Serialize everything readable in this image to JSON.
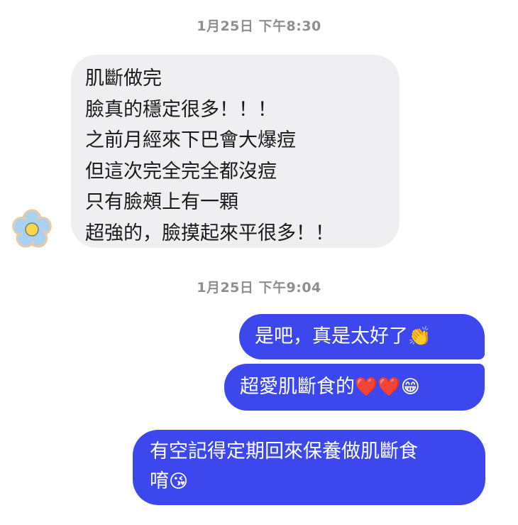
{
  "thread": {
    "timestamp_1": "1月25日 下午8:30",
    "timestamp_2": "1月25日 下午9:04"
  },
  "incoming_message": {
    "lines": [
      "肌斷做完",
      "臉真的穩定很多！！！",
      "之前月經來下巴會大爆痘",
      "但這次完全完全都沒痘",
      "只有臉頰上有一顆",
      "超強的，臉摸起來平很多！！"
    ]
  },
  "outgoing_messages": [
    {
      "text": "是吧，真是太好了",
      "emoji": "👏"
    },
    {
      "text": "超愛肌斷食的",
      "emoji": "❤️❤️😁"
    },
    {
      "lines": [
        "有空記得定期回來保養做肌斷食",
        "唷"
      ],
      "emoji": "😘"
    }
  ],
  "avatar": {
    "icon": "flower-icon",
    "petal_color": "#a9d2f2",
    "center_color": "#f7d84a",
    "outline_color": "#e8c9a8"
  },
  "colors": {
    "outgoing_bubble": "#3c48ee",
    "incoming_bubble": "#efeff1",
    "timestamp": "#8e8e93"
  }
}
